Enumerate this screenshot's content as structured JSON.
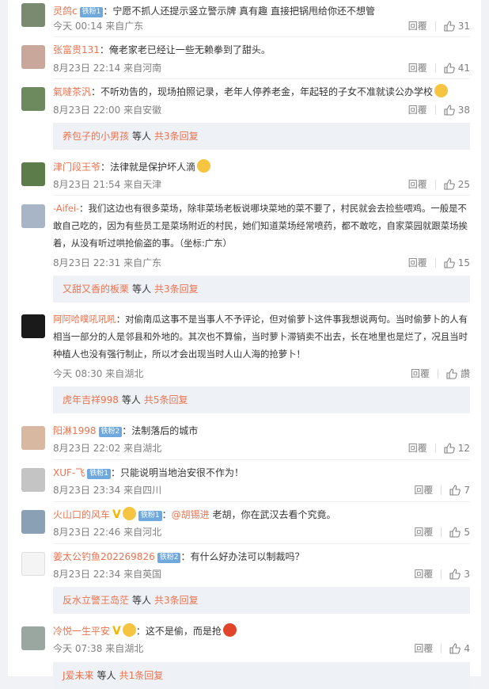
{
  "actions": {
    "reply": "回覆"
  },
  "comments": [
    {
      "name": "灵鸽c",
      "badge": "铁粉1",
      "text": "：宁愿不抓人还提示竖立警示牌 真有趣 直接把锅甩给你还不想管",
      "time": "今天 00:14 来自广东",
      "likes": "31"
    },
    {
      "name": "张富贵131",
      "text": "：俺老家老已经让一些无赖拳到了甜头。",
      "time": "8月23日 22:14 来自河南",
      "likes": "41"
    },
    {
      "name": "氣噠茶汎",
      "text": "：不听劝告的，现场拍照记录，老年人停养老金，年起轻的子女不准就读公办学校",
      "emoji": "thinking-emoji",
      "time": "8月23日 22:00 来自安徽",
      "likes": "38"
    },
    {
      "name": "津门段王爷",
      "text": "：法律就是保护坏人滴",
      "emoji": "laugh-cry-emoji",
      "time": "8月23日 21:54 来自天津",
      "likes": "25"
    },
    {
      "name": "-Aifei-",
      "text": "：我们这边也有很多菜场，除非菜场老板说哪块菜地的菜不要了，村民就会去捡些喂鸡。一般是不敢自己吃的，因为有些员工是菜场附近的村民，她们知道菜场经常喷药，都不敢吃，自家菜园就跟菜场挨着，从没有听过哄抢偷盗的事。（坐标:广东）",
      "time": "8月23日 22:31 来自广东",
      "likes": "15"
    },
    {
      "name": "阿阿哈噗吼吼吼",
      "text": "：对偷南瓜这事不是当事人不予评论，但对偷萝卜这件事我想说两句。当时偷萝卜的人有相当一部分的人是邻县和外地的。其次也不算偷，当时萝卜滞销卖不出去，长在地里也是烂了，况且当时种植人也没有强行制止，所以才会出现当时人山人海的抢萝卜！",
      "time": "今天 08:30 来自湖北",
      "likes": "讚"
    },
    {
      "name": "阳淋1998",
      "badge": "铁粉2",
      "text": "：法制落后的城市",
      "time": "8月23日 22:02 来自湖北",
      "likes": "12"
    },
    {
      "name": "XUF-飞",
      "badge": "铁粉1",
      "text": "：只能说明当地治安很不作为！",
      "time": "8月23日 23:34 来自四川",
      "likes": "7"
    },
    {
      "name": "火山口的风车",
      "badge": "铁粉1",
      "text_prefix": "：",
      "mention": "@胡锡进",
      "text": " 老胡，你在武汉去看个究竟。",
      "time": "8月23日 22:46 来自河北",
      "likes": "5"
    },
    {
      "name": "姜太公钓鱼202269826",
      "badge": "铁粉2",
      "text": "：有什么好办法可以制裁吗？",
      "time": "8月23日 22:34 来自英国",
      "likes": "3"
    },
    {
      "name": "冷悦一生平安",
      "text": "：这不是偷，而是抢",
      "emoji": "angry-emoji",
      "time": "今天 07:38 来自湖北",
      "likes": "4"
    }
  ],
  "reply_bars": [
    {
      "name": "养包子的小男孩",
      "mid": "等人",
      "count": "共3条回复"
    },
    {
      "name": "又甜又香的板栗",
      "mid": "等人",
      "count": "共3条回复"
    },
    {
      "name": "虎年吉祥998",
      "mid": "等人",
      "count": "共5条回复"
    },
    {
      "name": "反水立警王岛茫",
      "mid": "等人",
      "count": "共3条回复"
    },
    {
      "name": "J爱未来",
      "mid": "等人",
      "count": "共1条回复"
    }
  ],
  "colors": {
    "accent": "#eb7350",
    "meta": "#808080",
    "badge": "#6fa8dc",
    "replybg": "#eef1f5"
  }
}
